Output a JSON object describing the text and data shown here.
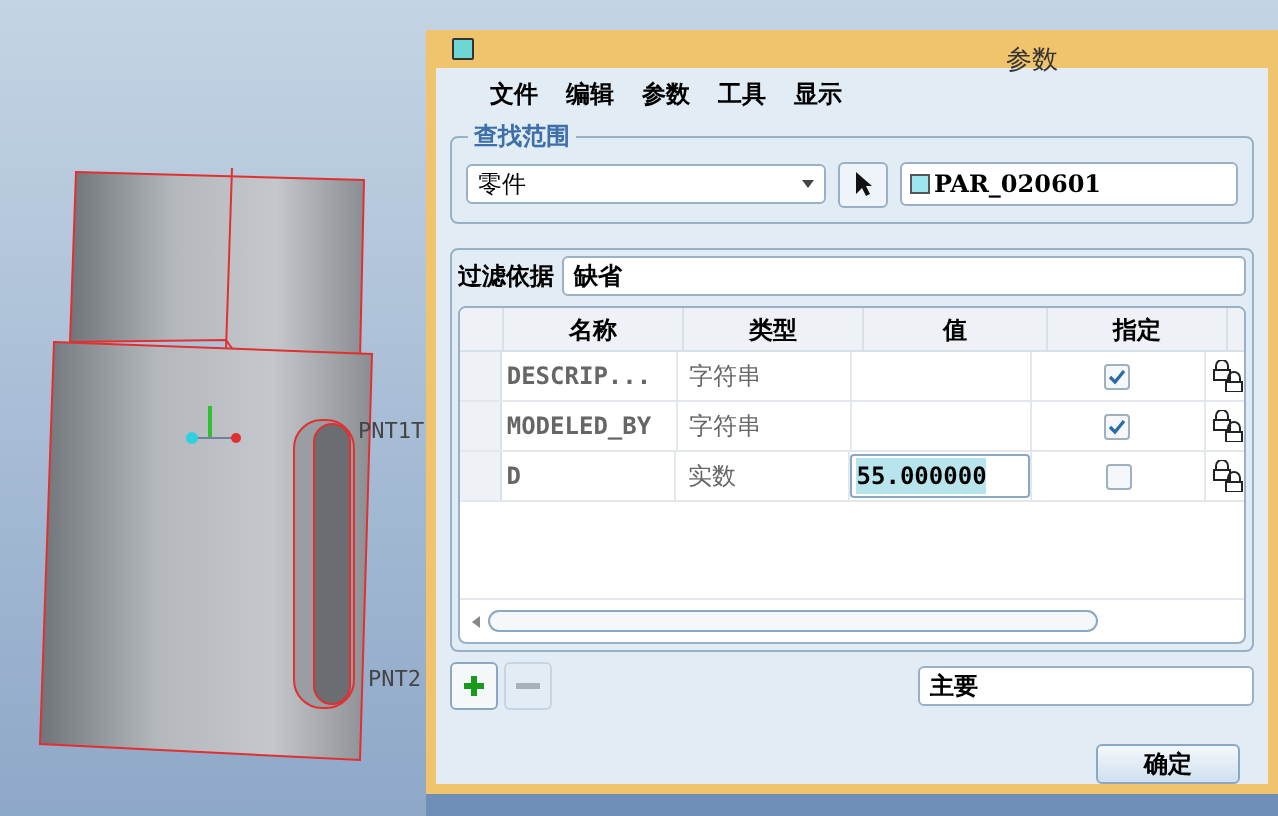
{
  "viewport": {
    "point_labels": [
      "PNT1T",
      "PNT2"
    ]
  },
  "window": {
    "title": "参数"
  },
  "menu": [
    "文件",
    "编辑",
    "参数",
    "工具",
    "显示"
  ],
  "scope": {
    "legend": "查找范围",
    "dropdown": "零件",
    "model": "PAR_020601"
  },
  "filter": {
    "label": "过滤依据",
    "value": "缺省"
  },
  "table": {
    "columns": [
      "名称",
      "类型",
      "值",
      "指定"
    ],
    "rows": [
      {
        "name": "DESCRIP...",
        "type": "字符串",
        "value": "",
        "designated": true,
        "editing": false
      },
      {
        "name": "MODELED_BY",
        "type": "字符串",
        "value": "",
        "designated": true,
        "editing": false
      },
      {
        "name": "D",
        "type": "实数",
        "value": "55.000000",
        "designated": false,
        "editing": true
      }
    ]
  },
  "row_buttons": [
    {
      "kind": "add",
      "disabled": false
    },
    {
      "kind": "remove",
      "disabled": true
    }
  ],
  "view_dropdown": "主要",
  "ok_button": "确定"
}
